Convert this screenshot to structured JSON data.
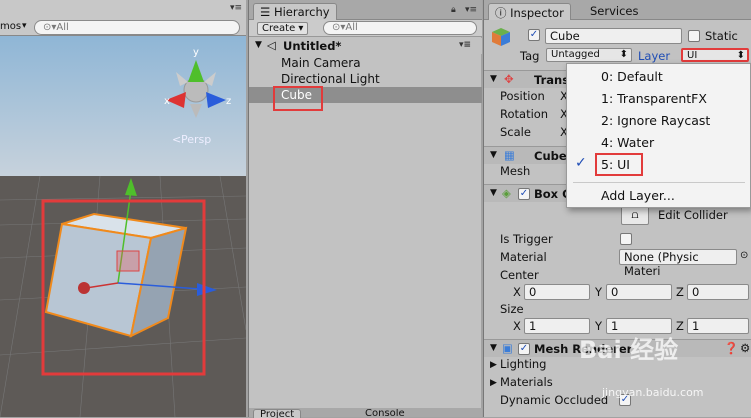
{
  "scene": {
    "toolbar_left": "mos",
    "search_placeholder": "All",
    "persp_label": "Persp",
    "gizmo_y": "y",
    "gizmo_x": "x",
    "gizmo_z": "z"
  },
  "hierarchy": {
    "tab": "Hierarchy",
    "create": "Create",
    "search_placeholder": "All",
    "scene_name": "Untitled*",
    "items": [
      {
        "label": "Main Camera"
      },
      {
        "label": "Directional Light"
      },
      {
        "label": "Cube"
      }
    ],
    "bottom_tabs": [
      "Project",
      "Console"
    ]
  },
  "inspector": {
    "tab": "Inspector",
    "tab2": "Services",
    "object_name": "Cube",
    "static_label": "Static",
    "tag_label": "Tag",
    "tag_value": "Untagged",
    "layer_label": "Layer",
    "layer_value": "UI",
    "transform": {
      "title": "Trans",
      "position": "Position",
      "rotation": "Rotation",
      "scale": "Scale",
      "x": "X"
    },
    "mesh_filter": {
      "title": "Cube",
      "mesh": "Mesh"
    },
    "box_collider": {
      "title": "Box C",
      "edit_collider": "Edit Collider",
      "is_trigger": "Is Trigger",
      "material": "Material",
      "material_value": "None (Physic Materi",
      "center": "Center",
      "size": "Size",
      "center_vals": {
        "x": "0",
        "y": "0",
        "z": "0"
      },
      "size_vals": {
        "x": "1",
        "y": "1",
        "z": "1"
      },
      "axis_x": "X",
      "axis_y": "Y",
      "axis_z": "Z"
    },
    "mesh_renderer": {
      "title": "Mesh Renderer",
      "lighting": "Lighting",
      "materials": "Materials",
      "dynamic_occluded": "Dynamic Occluded"
    }
  },
  "layer_dropdown": {
    "items": [
      {
        "label": "0: Default",
        "checked": false
      },
      {
        "label": "1: TransparentFX",
        "checked": false
      },
      {
        "label": "2: Ignore Raycast",
        "checked": false
      },
      {
        "label": "4: Water",
        "checked": false
      },
      {
        "label": "5: UI",
        "checked": true
      }
    ],
    "add_layer": "Add Layer...",
    "check_glyph": "✓"
  },
  "watermark": {
    "text": "Bai 经验",
    "sub": "jingyan.baidu.com"
  },
  "colors": {
    "selection_red": "#e23b3b",
    "gizmo_green": "#4fbf2b",
    "gizmo_red": "#d33",
    "gizmo_blue": "#2a5ddb",
    "cube_outline": "#f08a1c"
  }
}
